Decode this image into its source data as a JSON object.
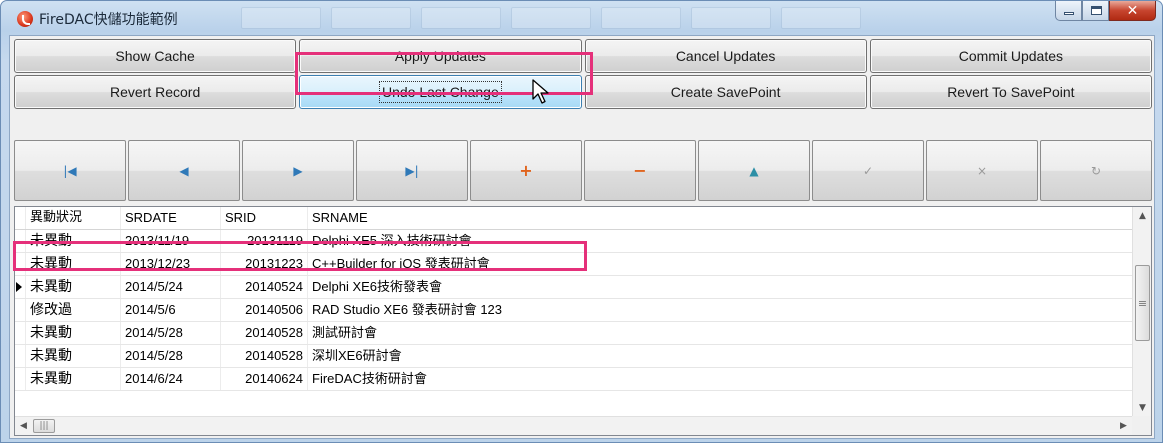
{
  "window": {
    "title": "FireDAC快儲功能範例"
  },
  "buttons": {
    "row1": [
      "Show Cache",
      "Apply Updates",
      "Cancel Updates",
      "Commit Updates"
    ],
    "row2": [
      "Revert Record",
      "Undo Last Change",
      "Create SavePoint",
      "Revert To SavePoint"
    ],
    "hot": "Undo Last Change"
  },
  "navigator": [
    {
      "name": "first",
      "glyph": "|◀",
      "enabled": true
    },
    {
      "name": "prior",
      "glyph": "◀",
      "enabled": true
    },
    {
      "name": "next",
      "glyph": "▶",
      "enabled": true
    },
    {
      "name": "last",
      "glyph": "▶|",
      "enabled": true
    },
    {
      "name": "insert",
      "glyph": "+",
      "enabled": true
    },
    {
      "name": "delete",
      "glyph": "−",
      "enabled": true
    },
    {
      "name": "edit",
      "glyph": "▲",
      "enabled": true
    },
    {
      "name": "post",
      "glyph": "✓",
      "enabled": false
    },
    {
      "name": "cancel",
      "glyph": "×",
      "enabled": false
    },
    {
      "name": "refresh",
      "glyph": "↻",
      "enabled": false
    }
  ],
  "grid": {
    "columns": [
      "異動狀況",
      "SRDATE",
      "SRID",
      "SRNAME"
    ],
    "rows": [
      {
        "status": "未異動",
        "date": "2013/11/19",
        "id": "20131119",
        "name": "Delphi XE5 深入技術研討會",
        "current": false
      },
      {
        "status": "未異動",
        "date": "2013/12/23",
        "id": "20131223",
        "name": "C++Builder for iOS 發表研討會",
        "current": false
      },
      {
        "status": "未異動",
        "date": "2014/5/24",
        "id": "20140524",
        "name": "Delphi XE6技術發表會",
        "current": true
      },
      {
        "status": "修改過",
        "date": "2014/5/6",
        "id": "20140506",
        "name": "RAD Studio XE6 發表研討會 123",
        "current": false
      },
      {
        "status": "未異動",
        "date": "2014/5/28",
        "id": "20140528",
        "name": "測試研討會",
        "current": false
      },
      {
        "status": "未異動",
        "date": "2014/5/28",
        "id": "20140528",
        "name": "深圳XE6研討會",
        "current": false
      },
      {
        "status": "未異動",
        "date": "2014/6/24",
        "id": "20140624",
        "name": "FireDAC技術研討會",
        "current": false
      }
    ]
  },
  "colors": {
    "highlight": "#e5307a",
    "nav_blue": "#2f79b8",
    "nav_orange": "#e0631c",
    "nav_teal": "#2c8fa6"
  }
}
